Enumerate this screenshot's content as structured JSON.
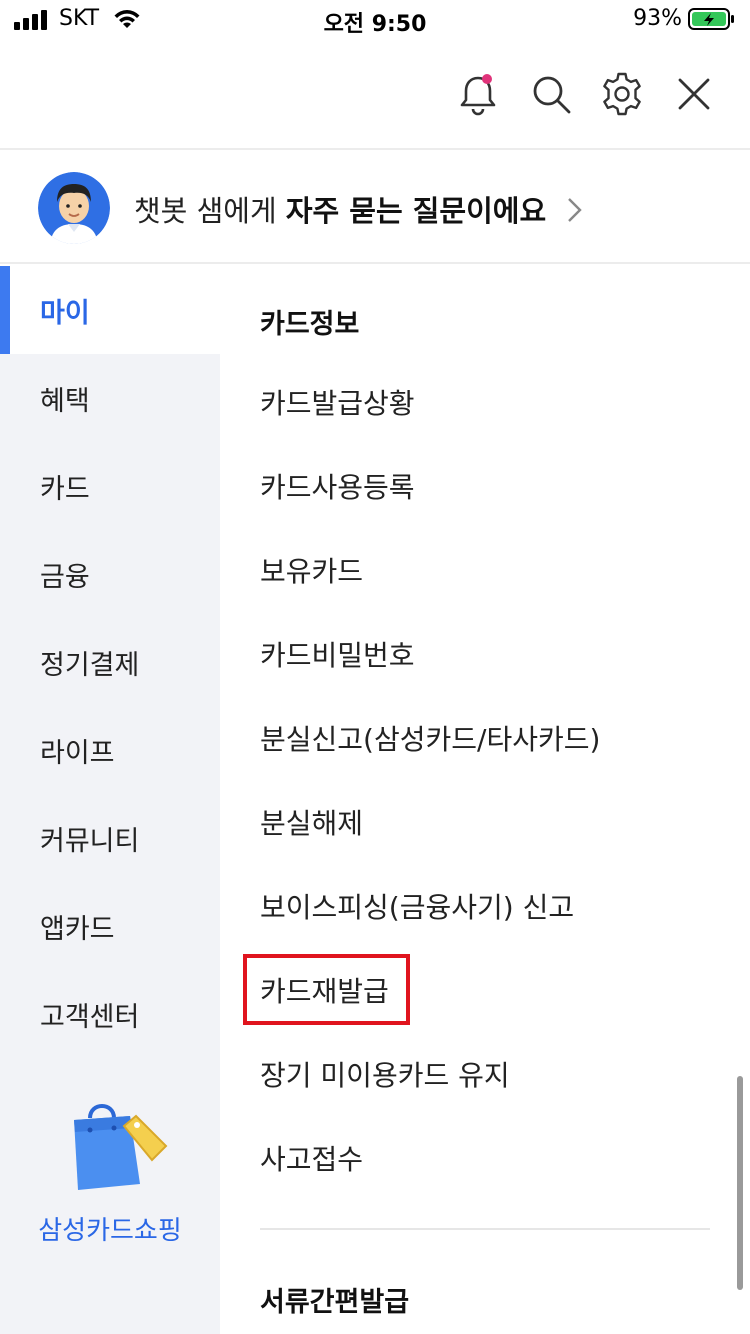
{
  "status_bar": {
    "carrier": "SKT",
    "time": "오전 9:50",
    "battery": "93%"
  },
  "header": {
    "icons": [
      "bell-icon",
      "search-icon",
      "gear-icon",
      "close-icon"
    ],
    "notification_dot_color": "#e0337a"
  },
  "chatbot": {
    "text_regular": "챗봇 샘에게 ",
    "text_bold": "자주 묻는 질문이에요"
  },
  "sidebar": {
    "items": [
      {
        "label": "마이",
        "active": true
      },
      {
        "label": "혜택"
      },
      {
        "label": "카드"
      },
      {
        "label": "금융"
      },
      {
        "label": "정기결제"
      },
      {
        "label": "라이프"
      },
      {
        "label": "커뮤니티"
      },
      {
        "label": "앱카드"
      },
      {
        "label": "고객센터"
      }
    ],
    "shopping_label": "삼성카드쇼핑"
  },
  "main": {
    "section_title": "카드정보",
    "items": [
      "카드발급상황",
      "카드사용등록",
      "보유카드",
      "카드비밀번호",
      "분실신고(삼성카드/타사카드)",
      "분실해제",
      "보이스피싱(금융사기) 신고",
      "카드재발급",
      "장기 미이용카드 유지",
      "사고접수"
    ],
    "highlighted_item": "카드재발급",
    "next_section_title": "서류간편발급"
  },
  "colors": {
    "accent": "#2a67e6",
    "highlight_border": "#e0141e",
    "sidebar_bg": "#f2f3f7",
    "battery_green": "#34c759"
  }
}
